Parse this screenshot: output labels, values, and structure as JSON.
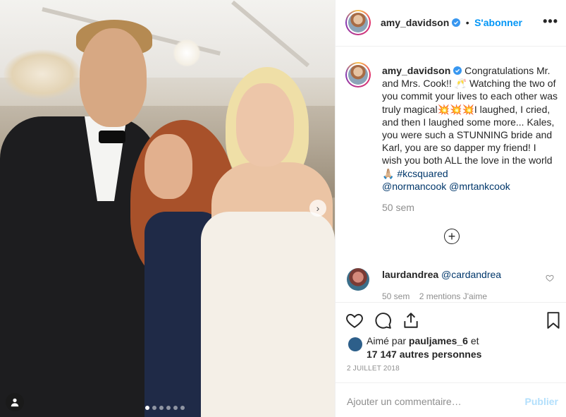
{
  "post": {
    "username": "amy_davidson",
    "follow_label": "S'abonner",
    "separator": "•",
    "more_label": "•••"
  },
  "caption": {
    "username": "amy_davidson",
    "text_part1": "Congratulations Mr. and Mrs. Cook!! 🥂 Watching the two of you commit your lives to each other was truly magical💥💥💥I laughed, I cried, and then I laughed some more... Kales, you were such a STUNNING bride and Karl, you are so dapper my friend! I wish you both ALL the love in the world🙏🏼 ",
    "hashtag": "#kcsquared",
    "mention1": "@normancook",
    "mention2": "@mrtankcook",
    "age": "50 sem"
  },
  "comments": [
    {
      "username": "laurdandrea",
      "text": "@cardandrea",
      "age": "50 sem",
      "likes": "2 mentions J'aime"
    }
  ],
  "likes": {
    "prefix": "Aimé par",
    "user": "pauljames_6",
    "connector": "et",
    "others": "17 147 autres personnes"
  },
  "date": "2 JUILLET 2018",
  "add_comment": {
    "placeholder": "Ajouter un commentaire…",
    "post_label": "Publier"
  },
  "carousel": {
    "total": 6,
    "active": 1
  },
  "icons": {
    "verified": "verified-badge-icon",
    "like": "heart-icon",
    "comment": "comment-icon",
    "share": "share-icon",
    "save": "bookmark-icon",
    "add": "plus-circle-icon",
    "next": "chevron-right-icon",
    "tag": "user-tag-icon"
  },
  "colors": {
    "link": "#00376b",
    "follow": "#0095f6",
    "muted": "#8e8e8e"
  }
}
